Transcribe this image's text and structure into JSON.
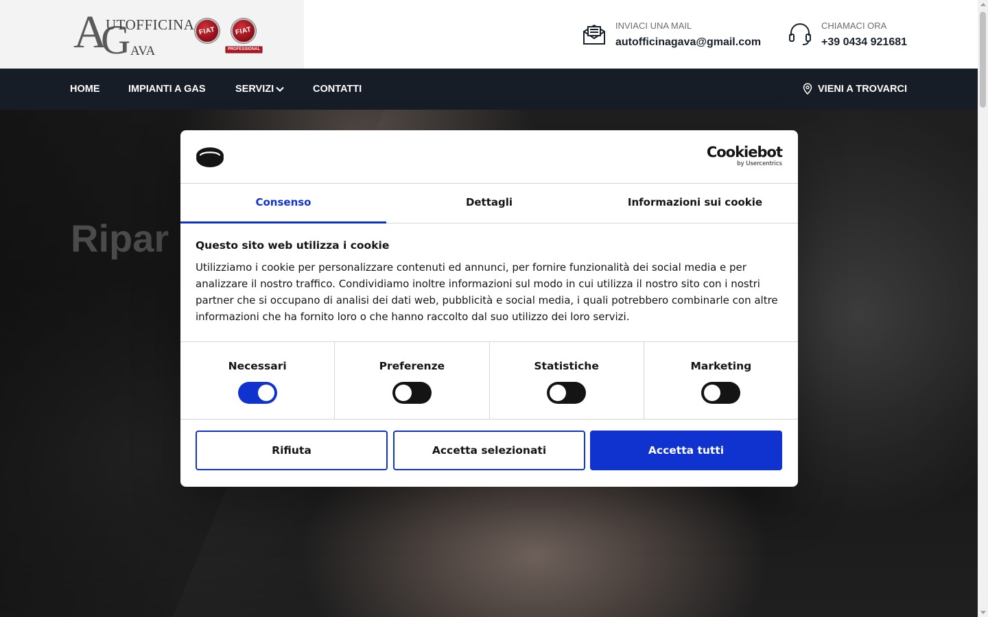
{
  "header": {
    "logo": {
      "line1": "UTOFFICINA",
      "line2": "AVA",
      "big_a": "A",
      "big_g": "G",
      "badge1": "FIAT",
      "badge2": "FIAT",
      "badge2_sub": "PROFESSIONAL"
    },
    "mail": {
      "label": "INVIACI UNA MAIL",
      "value": "autofficinagava@gmail.com",
      "icon": "mail-icon"
    },
    "phone": {
      "label": "CHIAMACI ORA",
      "value": "+39 0434 921681",
      "icon": "headset-icon"
    }
  },
  "nav": {
    "items": [
      {
        "label": "HOME"
      },
      {
        "label": "IMPIANTI A GAS"
      },
      {
        "label": "SERVIZI",
        "icon": "chevron-down-icon"
      },
      {
        "label": "CONTATTI"
      }
    ],
    "visit": {
      "label": "VIENI A TROVARCI",
      "icon": "map-pin-icon"
    }
  },
  "hero": {
    "title": "Ripar"
  },
  "cookie_dialog": {
    "brand": {
      "name": "Cookiebot",
      "sub": "by Usercentrics"
    },
    "tabs": [
      {
        "label": "Consenso",
        "active": true
      },
      {
        "label": "Dettagli",
        "active": false
      },
      {
        "label": "Informazioni sui cookie",
        "active": false
      }
    ],
    "title": "Questo sito web utilizza i cookie",
    "text": "Utilizziamo i cookie per personalizzare contenuti ed annunci, per fornire funzionalità dei social media e per analizzare il nostro traffico. Condividiamo inoltre informazioni sul modo in cui utilizza il nostro sito con i nostri partner che si occupano di analisi dei dati web, pubblicità e social media, i quali potrebbero combinarle con altre informazioni che ha fornito loro o che hanno raccolto dal suo utilizzo dei loro servizi.",
    "toggles": [
      {
        "label": "Necessari",
        "on": true
      },
      {
        "label": "Preferenze",
        "on": false
      },
      {
        "label": "Statistiche",
        "on": false
      },
      {
        "label": "Marketing",
        "on": false
      }
    ],
    "buttons": {
      "reject": "Rifiuta",
      "accept_selected": "Accetta selezionati",
      "accept_all": "Accetta tutti"
    },
    "colors": {
      "accent": "#1032cf",
      "text": "#141414"
    }
  },
  "colors": {
    "nav_bg": "#171d27",
    "header_bg": "#ffffff",
    "logo_bg": "#f3f3f3"
  }
}
